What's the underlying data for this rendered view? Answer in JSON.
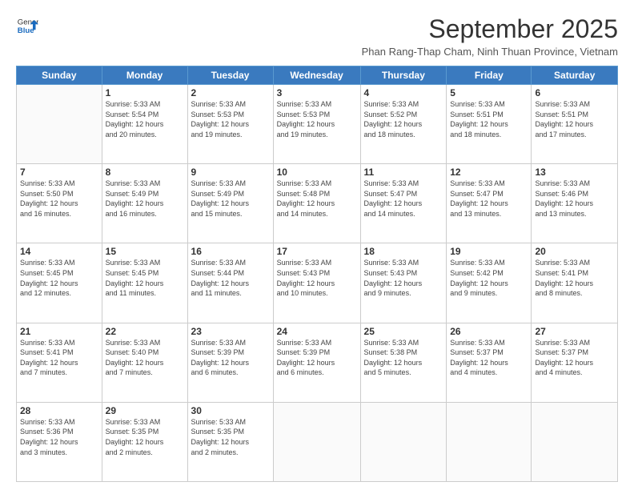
{
  "logo": {
    "general": "General",
    "blue": "Blue"
  },
  "title": "September 2025",
  "subtitle": "Phan Rang-Thap Cham, Ninh Thuan Province, Vietnam",
  "days": [
    "Sunday",
    "Monday",
    "Tuesday",
    "Wednesday",
    "Thursday",
    "Friday",
    "Saturday"
  ],
  "weeks": [
    [
      {
        "day": "",
        "info": ""
      },
      {
        "day": "1",
        "info": "Sunrise: 5:33 AM\nSunset: 5:54 PM\nDaylight: 12 hours\nand 20 minutes."
      },
      {
        "day": "2",
        "info": "Sunrise: 5:33 AM\nSunset: 5:53 PM\nDaylight: 12 hours\nand 19 minutes."
      },
      {
        "day": "3",
        "info": "Sunrise: 5:33 AM\nSunset: 5:53 PM\nDaylight: 12 hours\nand 19 minutes."
      },
      {
        "day": "4",
        "info": "Sunrise: 5:33 AM\nSunset: 5:52 PM\nDaylight: 12 hours\nand 18 minutes."
      },
      {
        "day": "5",
        "info": "Sunrise: 5:33 AM\nSunset: 5:51 PM\nDaylight: 12 hours\nand 18 minutes."
      },
      {
        "day": "6",
        "info": "Sunrise: 5:33 AM\nSunset: 5:51 PM\nDaylight: 12 hours\nand 17 minutes."
      }
    ],
    [
      {
        "day": "7",
        "info": "Sunrise: 5:33 AM\nSunset: 5:50 PM\nDaylight: 12 hours\nand 16 minutes."
      },
      {
        "day": "8",
        "info": "Sunrise: 5:33 AM\nSunset: 5:49 PM\nDaylight: 12 hours\nand 16 minutes."
      },
      {
        "day": "9",
        "info": "Sunrise: 5:33 AM\nSunset: 5:49 PM\nDaylight: 12 hours\nand 15 minutes."
      },
      {
        "day": "10",
        "info": "Sunrise: 5:33 AM\nSunset: 5:48 PM\nDaylight: 12 hours\nand 14 minutes."
      },
      {
        "day": "11",
        "info": "Sunrise: 5:33 AM\nSunset: 5:47 PM\nDaylight: 12 hours\nand 14 minutes."
      },
      {
        "day": "12",
        "info": "Sunrise: 5:33 AM\nSunset: 5:47 PM\nDaylight: 12 hours\nand 13 minutes."
      },
      {
        "day": "13",
        "info": "Sunrise: 5:33 AM\nSunset: 5:46 PM\nDaylight: 12 hours\nand 13 minutes."
      }
    ],
    [
      {
        "day": "14",
        "info": "Sunrise: 5:33 AM\nSunset: 5:45 PM\nDaylight: 12 hours\nand 12 minutes."
      },
      {
        "day": "15",
        "info": "Sunrise: 5:33 AM\nSunset: 5:45 PM\nDaylight: 12 hours\nand 11 minutes."
      },
      {
        "day": "16",
        "info": "Sunrise: 5:33 AM\nSunset: 5:44 PM\nDaylight: 12 hours\nand 11 minutes."
      },
      {
        "day": "17",
        "info": "Sunrise: 5:33 AM\nSunset: 5:43 PM\nDaylight: 12 hours\nand 10 minutes."
      },
      {
        "day": "18",
        "info": "Sunrise: 5:33 AM\nSunset: 5:43 PM\nDaylight: 12 hours\nand 9 minutes."
      },
      {
        "day": "19",
        "info": "Sunrise: 5:33 AM\nSunset: 5:42 PM\nDaylight: 12 hours\nand 9 minutes."
      },
      {
        "day": "20",
        "info": "Sunrise: 5:33 AM\nSunset: 5:41 PM\nDaylight: 12 hours\nand 8 minutes."
      }
    ],
    [
      {
        "day": "21",
        "info": "Sunrise: 5:33 AM\nSunset: 5:41 PM\nDaylight: 12 hours\nand 7 minutes."
      },
      {
        "day": "22",
        "info": "Sunrise: 5:33 AM\nSunset: 5:40 PM\nDaylight: 12 hours\nand 7 minutes."
      },
      {
        "day": "23",
        "info": "Sunrise: 5:33 AM\nSunset: 5:39 PM\nDaylight: 12 hours\nand 6 minutes."
      },
      {
        "day": "24",
        "info": "Sunrise: 5:33 AM\nSunset: 5:39 PM\nDaylight: 12 hours\nand 6 minutes."
      },
      {
        "day": "25",
        "info": "Sunrise: 5:33 AM\nSunset: 5:38 PM\nDaylight: 12 hours\nand 5 minutes."
      },
      {
        "day": "26",
        "info": "Sunrise: 5:33 AM\nSunset: 5:37 PM\nDaylight: 12 hours\nand 4 minutes."
      },
      {
        "day": "27",
        "info": "Sunrise: 5:33 AM\nSunset: 5:37 PM\nDaylight: 12 hours\nand 4 minutes."
      }
    ],
    [
      {
        "day": "28",
        "info": "Sunrise: 5:33 AM\nSunset: 5:36 PM\nDaylight: 12 hours\nand 3 minutes."
      },
      {
        "day": "29",
        "info": "Sunrise: 5:33 AM\nSunset: 5:35 PM\nDaylight: 12 hours\nand 2 minutes."
      },
      {
        "day": "30",
        "info": "Sunrise: 5:33 AM\nSunset: 5:35 PM\nDaylight: 12 hours\nand 2 minutes."
      },
      {
        "day": "",
        "info": ""
      },
      {
        "day": "",
        "info": ""
      },
      {
        "day": "",
        "info": ""
      },
      {
        "day": "",
        "info": ""
      }
    ]
  ]
}
